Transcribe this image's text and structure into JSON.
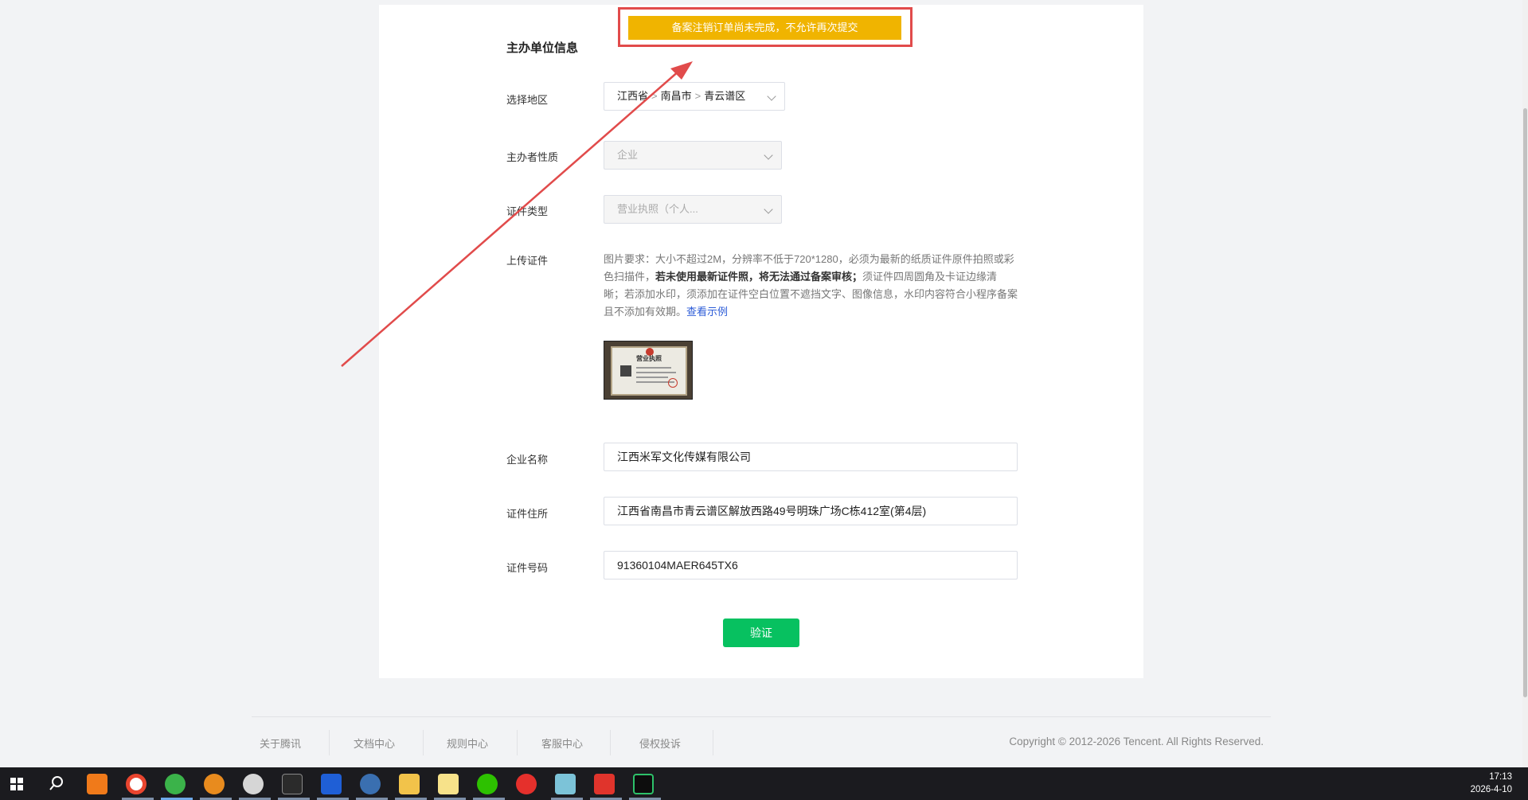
{
  "toast": {
    "text": "备案注销订单尚未完成，不允许再次提交"
  },
  "form": {
    "section_title": "主办单位信息",
    "region": {
      "label": "选择地区",
      "province": "江西省",
      "city": "南昌市",
      "district": "青云谱区",
      "separator": ">"
    },
    "org_nature": {
      "label": "主办者性质",
      "value": "企业"
    },
    "cert_type": {
      "label": "证件类型",
      "value": "营业执照（个人..."
    },
    "upload": {
      "label": "上传证件",
      "note_part1": "图片要求：大小不超过2M，分辨率不低于720*1280，必须为最新的纸质证件原件拍照或彩色扫描件，",
      "note_bold": "若未使用最新证件照，将无法通过备案审核；",
      "note_part2": "须证件四周圆角及卡证边缘清晰；若添加水印，须添加在证件空白位置不遮挡文字、图像信息，水印内容符合小程序备案且不添加有效期。",
      "example_link": "查看示例",
      "thumb_title": "营业执照"
    },
    "company_name": {
      "label": "企业名称",
      "value": "江西米军文化传媒有限公司"
    },
    "cert_address": {
      "label": "证件住所",
      "value": "江西省南昌市青云谱区解放西路49号明珠广场C栋412室(第4层)"
    },
    "cert_number": {
      "label": "证件号码",
      "value": "91360104MAER645TX6"
    },
    "verify_button": "验证"
  },
  "footer": {
    "links": [
      "关于腾讯",
      "文档中心",
      "规则中心",
      "客服中心",
      "侵权投诉"
    ],
    "copyright": "Copyright © 2012-2026 Tencent. All Rights Reserved."
  },
  "taskbar": {
    "time": "17:13",
    "date": "2026-4-10",
    "icons": [
      "windows-start-icon",
      "search-icon",
      "app-orange-icon",
      "chrome-icon",
      "browser-green-icon",
      "sun-app-icon",
      "chat-bubble-icon",
      "box-app-icon",
      "x-app-icon",
      "globe-app-icon",
      "file-explorer-icon",
      "notepad-icon",
      "wechat-icon",
      "netease-music-icon",
      "book-app-icon",
      "wps-icon",
      "monitor-app-icon"
    ]
  },
  "colors": {
    "accent_green": "#07c160",
    "toast_bg": "#f0b400",
    "annotation_red": "#e14b4b",
    "link_blue": "#2b5bd7"
  }
}
